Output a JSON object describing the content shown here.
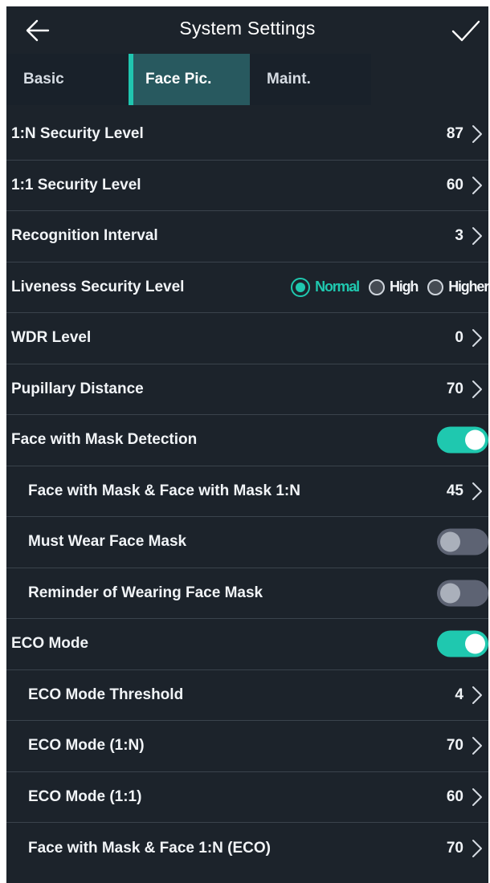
{
  "header": {
    "title": "System Settings",
    "back_icon": "arrow-left-icon",
    "confirm_icon": "checkmark-icon"
  },
  "tabs": [
    {
      "label": "Basic",
      "active": false
    },
    {
      "label": "Face Pic.",
      "active": true
    },
    {
      "label": "Maint.",
      "active": false
    }
  ],
  "settings": {
    "one_n_security": {
      "label": "1:N Security Level",
      "value": "87"
    },
    "one_one_security": {
      "label": "1:1 Security Level",
      "value": "60"
    },
    "recognition_interval": {
      "label": "Recognition Interval",
      "value": "3"
    },
    "liveness": {
      "label": "Liveness Security Level",
      "options": [
        "Normal",
        "High",
        "Higher"
      ],
      "selected": "Normal"
    },
    "wdr": {
      "label": "WDR Level",
      "value": "0"
    },
    "pupillary": {
      "label": "Pupillary Distance",
      "value": "70"
    },
    "mask_detection": {
      "label": "Face with Mask Detection",
      "enabled": true
    },
    "mask_1n": {
      "label": "Face with Mask & Face with Mask 1:N",
      "value": "45"
    },
    "must_wear": {
      "label": "Must Wear Face Mask",
      "enabled": false
    },
    "reminder": {
      "label": "Reminder of Wearing Face Mask",
      "enabled": false
    },
    "eco_mode": {
      "label": "ECO Mode",
      "enabled": true
    },
    "eco_threshold": {
      "label": "ECO Mode Threshold",
      "value": "4"
    },
    "eco_1n": {
      "label": "ECO Mode (1:N)",
      "value": "70"
    },
    "eco_11": {
      "label": "ECO Mode (1:1)",
      "value": "60"
    },
    "mask_1n_eco": {
      "label": "Face with Mask & Face 1:N (ECO)",
      "value": "70"
    }
  },
  "colors": {
    "background": "#1c232b",
    "accent": "#1fc8af",
    "active_tab": "#28595f",
    "divider": "#3a434c",
    "toggle_off": "#5d6373"
  },
  "icons": {
    "chevron": "chevron-right-icon"
  }
}
